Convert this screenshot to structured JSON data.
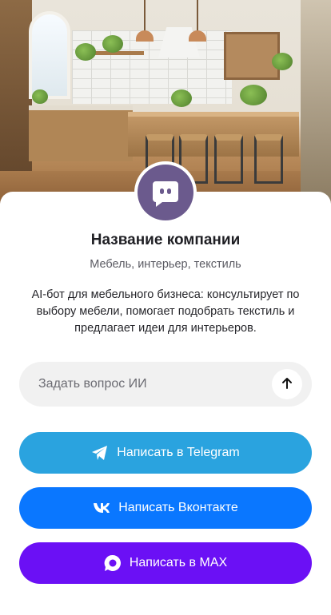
{
  "hero": {
    "image_alt": "kitchen-interior-photo"
  },
  "company": {
    "name": "Название компании",
    "tagline": "Мебель, интерьер, текстиль",
    "description": "AI-бот для мебельного бизнеса: консультирует по выбору мебели, помогает подобрать текстиль и предлагает идеи для интерьеров."
  },
  "ask": {
    "placeholder": "Задать вопрос ИИ",
    "value": "",
    "send_icon": "arrow-up-icon"
  },
  "buttons": {
    "telegram": {
      "label": "Написать в Telegram",
      "icon": "telegram-icon",
      "color": "#2aa3df"
    },
    "vk": {
      "label": "Написать Вконтакте",
      "icon": "vk-icon",
      "color": "#0a77ff"
    },
    "max": {
      "label": "Написать в MAX",
      "icon": "max-icon",
      "color": "#6b10f5"
    }
  },
  "colors": {
    "avatar_bg": "#6b5a8d",
    "input_bg": "#f1f1f1"
  }
}
